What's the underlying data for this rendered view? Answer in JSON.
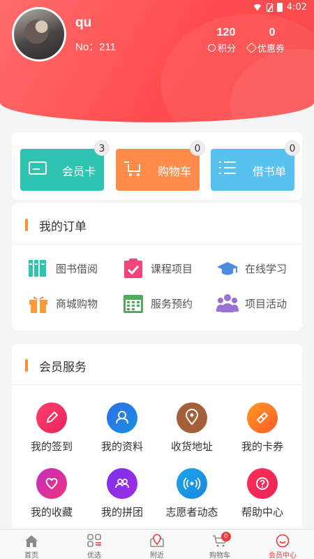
{
  "status_bar": {
    "time": "4:02"
  },
  "profile": {
    "username": "qu",
    "member_no": "No：211"
  },
  "stats": [
    {
      "value": "120",
      "label": "积分",
      "icon": "medal-icon"
    },
    {
      "value": "0",
      "label": "优惠券",
      "icon": "coupon-tag-icon"
    }
  ],
  "quick_actions": [
    {
      "label": "会员卡",
      "badge": "3",
      "icon": "member-card-icon",
      "color": "#2fc4b2"
    },
    {
      "label": "购物车",
      "badge": "0",
      "icon": "cart-icon",
      "color": "#ff8c4b"
    },
    {
      "label": "借书单",
      "badge": "0",
      "icon": "list-icon",
      "color": "#57c2ef"
    }
  ],
  "orders": {
    "title": "我的订单",
    "items": [
      {
        "label": "图书借阅",
        "icon": "books-icon"
      },
      {
        "label": "课程项目",
        "icon": "clipboard-check-icon"
      },
      {
        "label": "在线学习",
        "icon": "graduation-cap-icon"
      },
      {
        "label": "商城购物",
        "icon": "gift-icon"
      },
      {
        "label": "服务预约",
        "icon": "calendar-icon"
      },
      {
        "label": "项目活动",
        "icon": "group-icon"
      }
    ]
  },
  "services": {
    "title": "会员服务",
    "items": [
      {
        "label": "我的签到",
        "icon": "pen-icon"
      },
      {
        "label": "我的资料",
        "icon": "user-icon"
      },
      {
        "label": "收货地址",
        "icon": "location-pin-icon"
      },
      {
        "label": "我的卡券",
        "icon": "ticket-icon"
      },
      {
        "label": "我的收藏",
        "icon": "heart-icon"
      },
      {
        "label": "我的拼团",
        "icon": "team-icon"
      },
      {
        "label": "志愿者动态",
        "icon": "broadcast-icon"
      },
      {
        "label": "帮助中心",
        "icon": "help-icon"
      }
    ]
  },
  "tabbar": {
    "items": [
      {
        "label": "首页",
        "icon": "home-icon"
      },
      {
        "label": "优选",
        "icon": "grid-icon"
      },
      {
        "label": "附近",
        "icon": "map-pin-icon"
      },
      {
        "label": "购物车",
        "icon": "cart-icon",
        "badge": "0"
      },
      {
        "label": "会员中心",
        "icon": "member-icon",
        "active": true
      }
    ]
  },
  "colors": {
    "brand_red": "#ff4d4f",
    "accent_orange": "#ff8c2e",
    "tab_active": "#f0393c"
  }
}
